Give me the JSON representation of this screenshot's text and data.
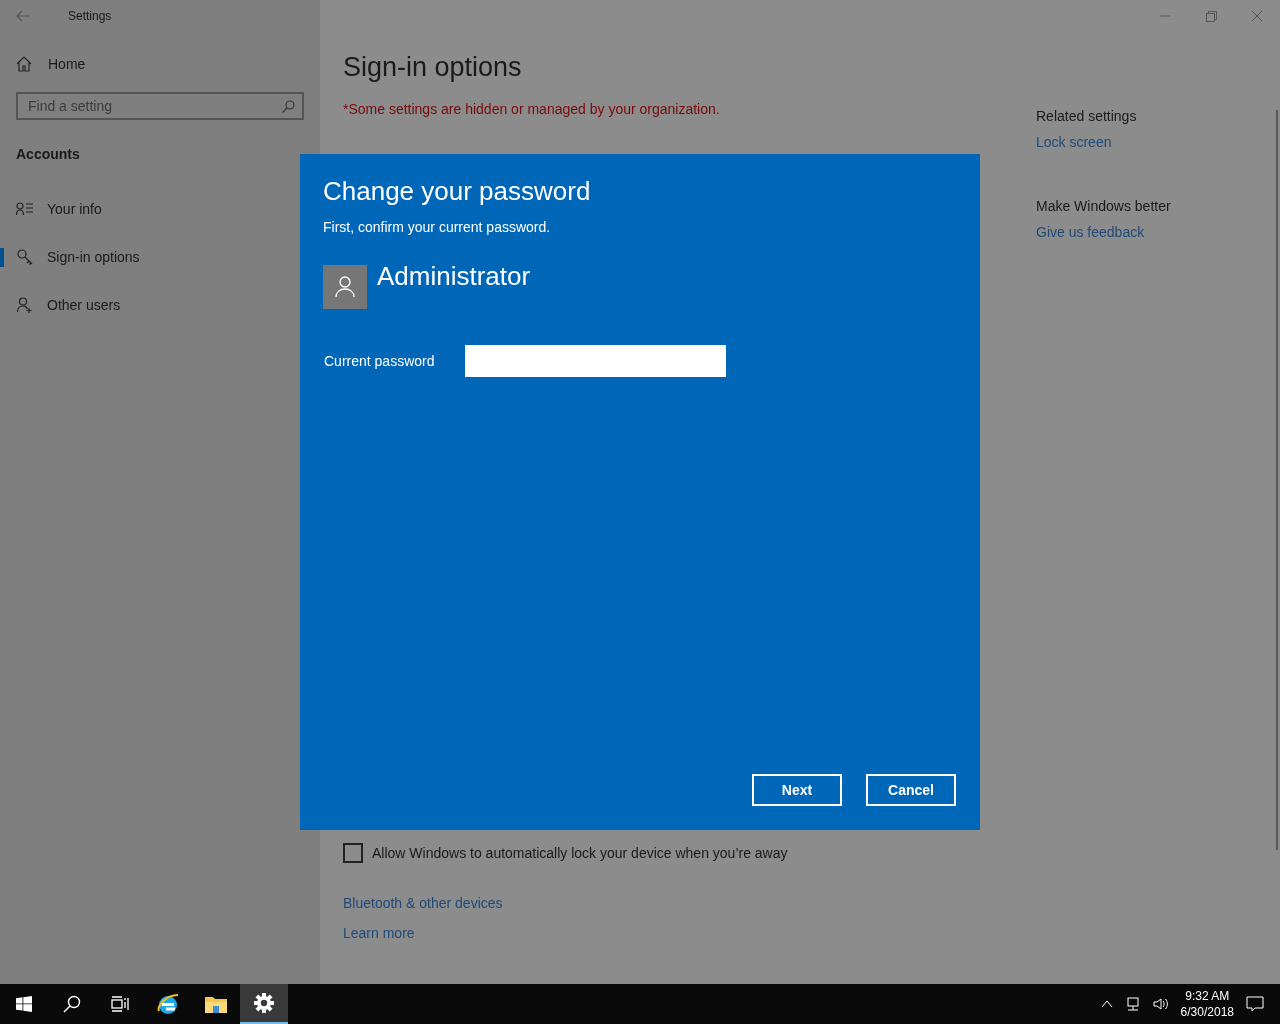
{
  "window": {
    "title": "Settings"
  },
  "sidebar": {
    "home": "Home",
    "search": {
      "placeholder": "Find a setting"
    },
    "section": "Accounts",
    "items": [
      {
        "label": "Your info",
        "kind": "info",
        "selected": false
      },
      {
        "label": "Sign-in options",
        "kind": "key",
        "selected": true
      },
      {
        "label": "Other users",
        "kind": "users",
        "selected": false
      }
    ]
  },
  "page": {
    "title": "Sign-in options",
    "notice": "*Some settings are hidden or managed by your organization.",
    "lock_option": {
      "label": "Allow Windows to automatically lock your device when you’re away",
      "checked": false
    },
    "links": [
      "Bluetooth & other devices",
      "Learn more"
    ]
  },
  "related": [
    {
      "heading": "Related settings",
      "link": "Lock screen"
    },
    {
      "heading": "Make Windows better",
      "link": "Give us feedback"
    }
  ],
  "dialog": {
    "title": "Change your password",
    "subtitle": "First, confirm your current password.",
    "user": "Administrator",
    "field_label": "Current password",
    "buttons": [
      "Next",
      "Cancel"
    ]
  },
  "taskbar": {
    "apps": [
      {
        "kind": "start",
        "selected": false
      },
      {
        "kind": "search",
        "selected": false
      },
      {
        "kind": "taskview",
        "selected": false
      },
      {
        "kind": "browser",
        "selected": false
      },
      {
        "kind": "folder",
        "selected": false
      },
      {
        "kind": "settings",
        "selected": true
      }
    ],
    "time": "9:32 AM",
    "date": "6/30/2018"
  }
}
